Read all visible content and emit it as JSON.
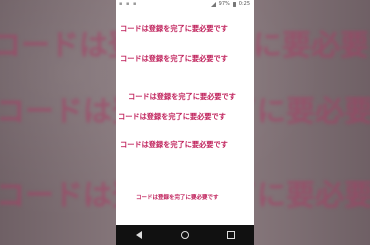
{
  "background": {
    "lines": [
      "コードは登録を完了に要必要で",
      "コードは登録を完了に要必要です",
      "コードは登録を完了に要必要で"
    ]
  },
  "status_bar": {
    "battery_percent": "97%",
    "time": "0:25"
  },
  "screen": {
    "lines": [
      "コードは登録を完了に要必要です",
      "コードは登録を完了に要必要です",
      "コードは登録を完了に要必要です",
      "コードは登録を完了に要必要です",
      "コードは登録を完了に要必要です",
      "コードは登録を完了に要必要です"
    ],
    "text_color": "#c0225c"
  },
  "nav_bar": {
    "icons": [
      "back-icon",
      "home-icon",
      "recents-icon"
    ]
  }
}
